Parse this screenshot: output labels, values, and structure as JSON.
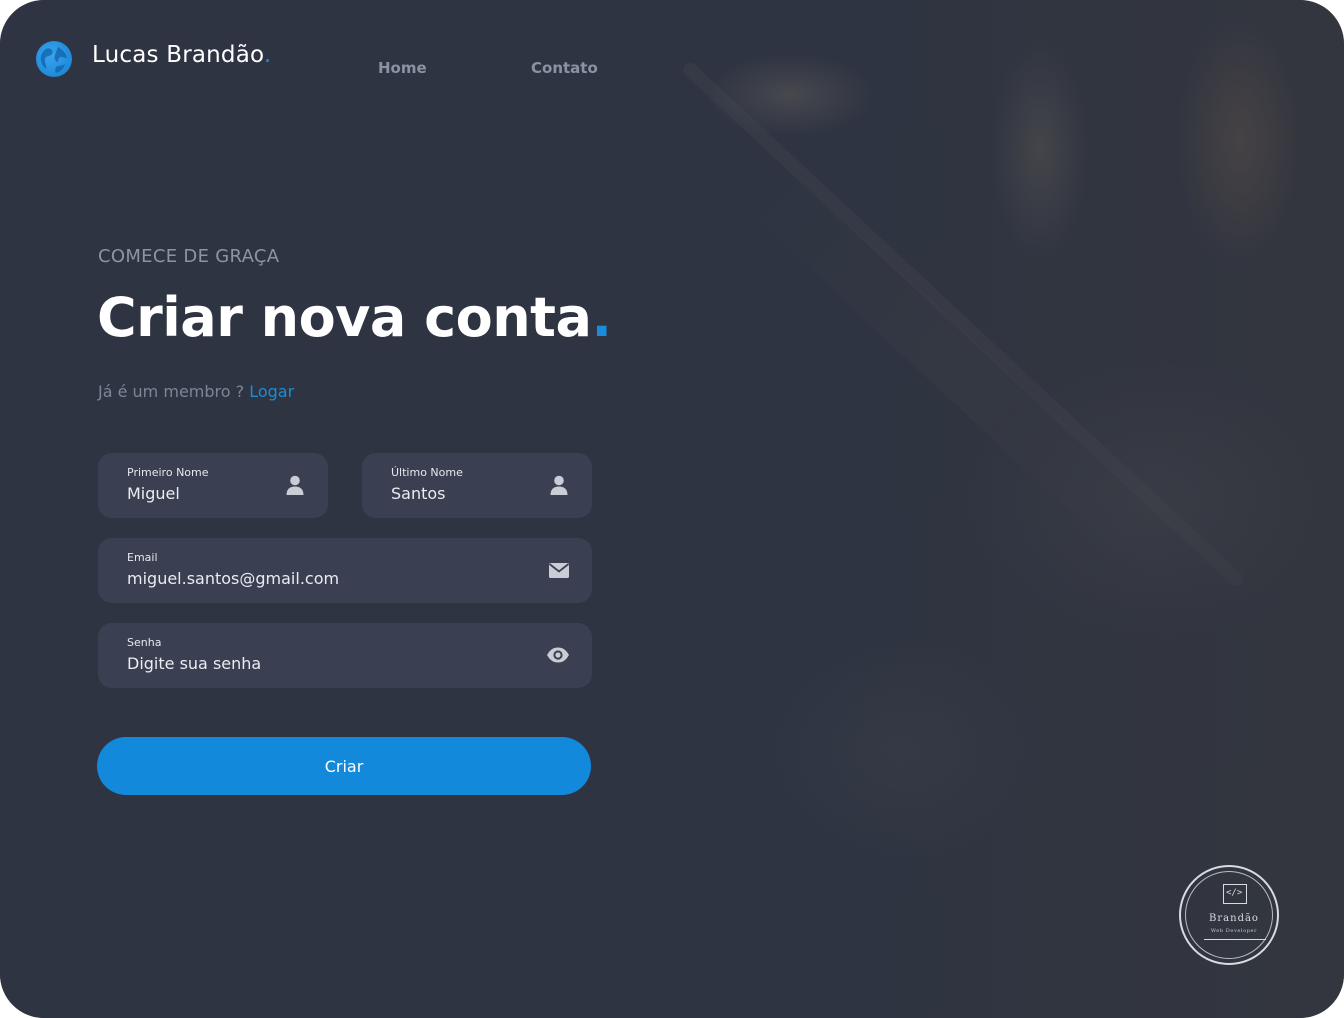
{
  "header": {
    "brand_name": "Lucas Brandão",
    "brand_dot": ".",
    "nav": [
      {
        "label": "Home"
      },
      {
        "label": "Contato"
      }
    ]
  },
  "hero": {
    "eyebrow": "COMECE DE GRAÇA",
    "title": "Criar nova conta",
    "title_dot": ".",
    "member_text": "Já é um membro ? ",
    "login_link": "Logar"
  },
  "form": {
    "first_name": {
      "label": "Primeiro Nome",
      "value": "Miguel",
      "icon": "user-icon"
    },
    "last_name": {
      "label": "Último Nome",
      "value": "Santos",
      "icon": "user-icon"
    },
    "email": {
      "label": "Email",
      "value": "miguel.santos@gmail.com",
      "icon": "envelope-icon"
    },
    "password": {
      "label": "Senha",
      "placeholder": "Digite sua senha",
      "icon": "eye-icon"
    },
    "submit_label": "Criar"
  },
  "watermark": {
    "name": "Brandão",
    "subtitle": "Web Developer",
    "icon": "code-icon"
  },
  "colors": {
    "background": "#2e3442",
    "field": "#3a4051",
    "accent": "#1389dc",
    "muted": "#8d95a4"
  }
}
